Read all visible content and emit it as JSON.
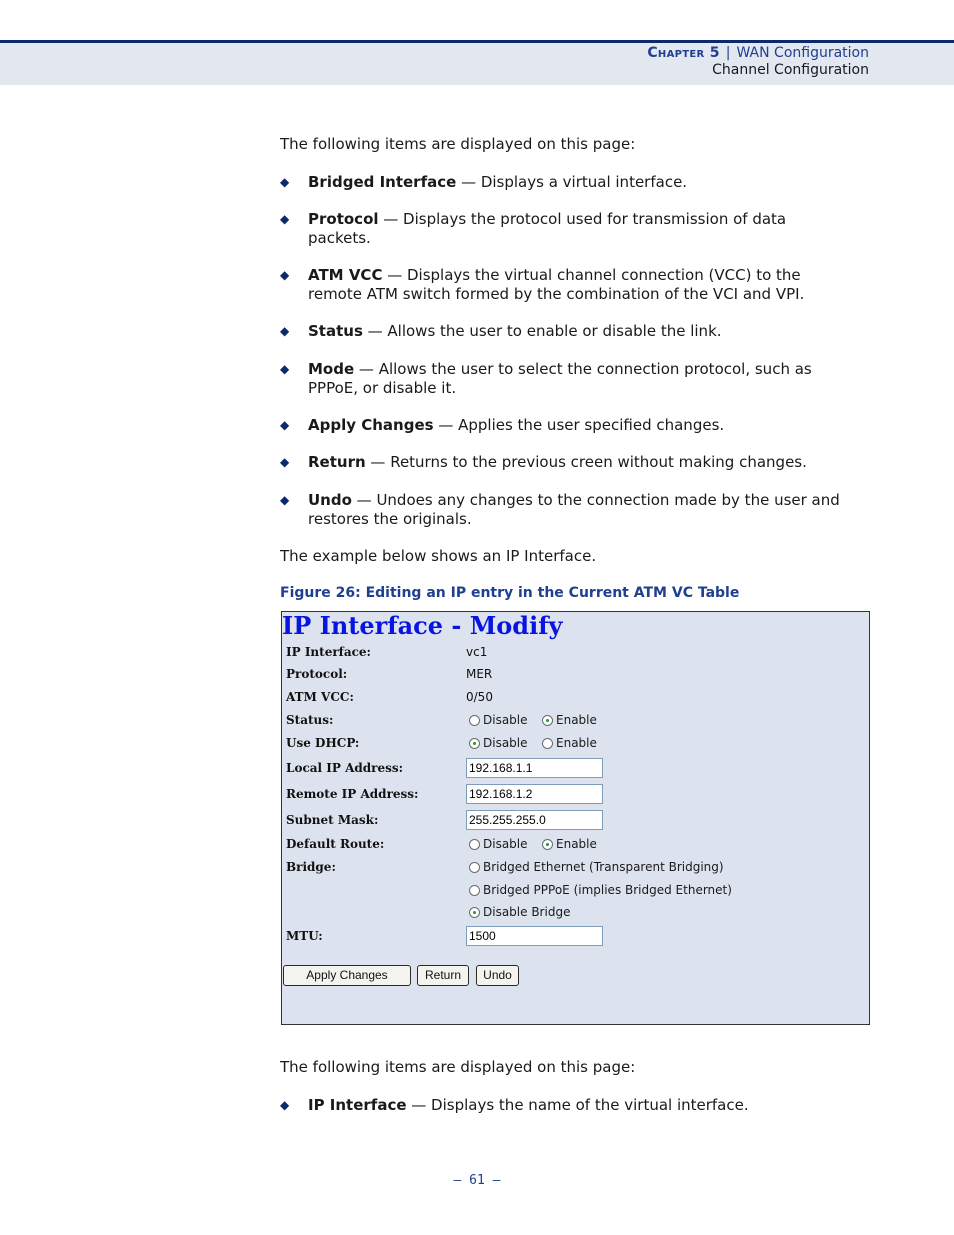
{
  "header": {
    "chapter": "Chapter 5",
    "separator": "|",
    "chapter_title": "WAN Configuration",
    "section": "Channel Configuration"
  },
  "intro1": "The following items are displayed on this page:",
  "bullets1": [
    {
      "term": "Bridged Interface",
      "desc": " — Displays a virtual interface."
    },
    {
      "term": "Protocol",
      "desc": " — Displays the protocol used for transmission of data packets."
    },
    {
      "term": "ATM VCC",
      "desc": " — Displays the virtual channel connection (VCC) to the remote ATM switch formed by the combination of the VCI and VPI."
    },
    {
      "term": "Status",
      "desc": " — Allows the user to enable or disable the link."
    },
    {
      "term": "Mode",
      "desc": " — Allows the user to select the connection protocol, such as PPPoE, or disable it."
    },
    {
      "term": "Apply Changes",
      "desc": " — Applies the user specified changes."
    },
    {
      "term": "Return",
      "desc": " — Returns to the previous creen without making changes."
    },
    {
      "term": "Undo",
      "desc": " — Undoes any changes to the connection made by the user and restores the originals."
    }
  ],
  "example_text": "The example below shows an IP Interface.",
  "figure_caption": "Figure 26:  Editing an IP entry in the Current ATM VC Table",
  "form": {
    "title": "IP Interface - Modify",
    "ip_interface": {
      "label": "IP Interface:",
      "value": "vc1"
    },
    "protocol": {
      "label": "Protocol:",
      "value": "MER"
    },
    "atm_vcc": {
      "label": "ATM VCC:",
      "value": "0/50"
    },
    "status": {
      "label": "Status:",
      "options": [
        "Disable",
        "Enable"
      ],
      "selected": "Enable"
    },
    "use_dhcp": {
      "label": "Use DHCP:",
      "options": [
        "Disable",
        "Enable"
      ],
      "selected": "Disable"
    },
    "local_ip": {
      "label": "Local IP Address:",
      "value": "192.168.1.1"
    },
    "remote_ip": {
      "label": "Remote IP Address:",
      "value": "192.168.1.2"
    },
    "subnet_mask": {
      "label": "Subnet Mask:",
      "value": "255.255.255.0"
    },
    "default_route": {
      "label": "Default Route:",
      "options": [
        "Disable",
        "Enable"
      ],
      "selected": "Enable"
    },
    "bridge": {
      "label": "Bridge:",
      "options": [
        "Bridged Ethernet (Transparent Bridging)",
        "Bridged PPPoE (implies Bridged Ethernet)",
        "Disable Bridge"
      ],
      "selected": "Disable Bridge"
    },
    "mtu": {
      "label": "MTU:",
      "value": "1500"
    },
    "buttons": {
      "apply": "Apply Changes",
      "return": "Return",
      "undo": "Undo"
    }
  },
  "intro2": "The following items are displayed on this page:",
  "bullets2": [
    {
      "term": "IP Interface",
      "desc": " — Displays the name of the virtual interface."
    }
  ],
  "page_number": "–  61  –",
  "colors": {
    "accent": "#0b2a6b",
    "caption": "#1f3f8f",
    "form_title": "#0a14e0",
    "form_bg": "#dde3ee"
  }
}
